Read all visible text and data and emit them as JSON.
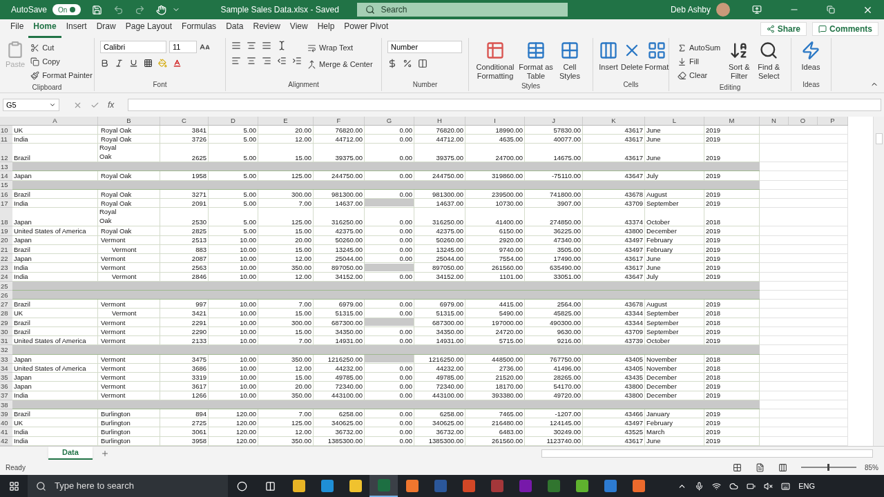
{
  "titlebar": {
    "autosave_label": "AutoSave",
    "autosave_on": true,
    "autosave_text": "On",
    "title": "Sample Sales Data.xlsx  -  Saved",
    "search_placeholder": "Search",
    "user": "Deb Ashby"
  },
  "tabs": [
    {
      "label": "File",
      "selected": false
    },
    {
      "label": "Home",
      "selected": true
    },
    {
      "label": "Insert",
      "selected": false
    },
    {
      "label": "Draw",
      "selected": false
    },
    {
      "label": "Page Layout",
      "selected": false
    },
    {
      "label": "Formulas",
      "selected": false
    },
    {
      "label": "Data",
      "selected": false
    },
    {
      "label": "Review",
      "selected": false
    },
    {
      "label": "View",
      "selected": false
    },
    {
      "label": "Help",
      "selected": false
    },
    {
      "label": "Power Pivot",
      "selected": false
    }
  ],
  "share": "Share",
  "comments": "Comments",
  "ribbon": {
    "clipboard": {
      "label": "Clipboard",
      "paste": "Paste",
      "paste_disabled": true,
      "cut": "Cut",
      "copy": "Copy",
      "format_painter": "Format Painter"
    },
    "font": {
      "label": "Font",
      "name": "Calibri",
      "size": "11"
    },
    "alignment": {
      "label": "Alignment",
      "wrap": "Wrap Text",
      "merge": "Merge & Center"
    },
    "number": {
      "label": "Number",
      "format": "Number"
    },
    "styles": {
      "label": "Styles",
      "buttons": [
        "Conditional Formatting",
        "Format as Table",
        "Cell Styles"
      ]
    },
    "cells": {
      "label": "Cells",
      "buttons": [
        "Insert",
        "Delete",
        "Format"
      ]
    },
    "editing": {
      "label": "Editing",
      "autosum": "AutoSum",
      "fill": "Fill",
      "clear": "Clear",
      "sort": "Sort & Filter",
      "find": "Find & Select"
    },
    "ideas": {
      "label": "Ideas",
      "button": "Ideas"
    }
  },
  "formula_bar": {
    "name_box": "G5",
    "fx": "fx"
  },
  "columns": [
    "A",
    "B",
    "C",
    "D",
    "E",
    "F",
    "G",
    "H",
    "I",
    "J",
    "K",
    "L",
    "M",
    "N",
    "O",
    "P"
  ],
  "rows": [
    {
      "n": "10",
      "kind": "data",
      "wrapped": false,
      "b_indented": false,
      "g_shaded": false,
      "cells": [
        "UK",
        "Royal Oak",
        "3841",
        "5.00",
        "20.00",
        "76820.00",
        "0.00",
        "76820.00",
        "18990.00",
        "57830.00",
        "43617",
        "June",
        "2019"
      ]
    },
    {
      "n": "11",
      "kind": "data",
      "wrapped": false,
      "b_indented": false,
      "g_shaded": false,
      "cells": [
        "India",
        "Royal Oak",
        "3726",
        "5.00",
        "12.00",
        "44712.00",
        "0.00",
        "44712.00",
        "4635.00",
        "40077.00",
        "43617",
        "June",
        "2019"
      ]
    },
    {
      "n": "12",
      "kind": "data",
      "wrapped": true,
      "b_indented": false,
      "g_shaded": false,
      "cells": [
        "Brazil",
        "Royal Oak",
        "2625",
        "5.00",
        "15.00",
        "39375.00",
        "0.00",
        "39375.00",
        "24700.00",
        "14675.00",
        "43617",
        "June",
        "2019"
      ]
    },
    {
      "n": "13",
      "kind": "band"
    },
    {
      "n": "14",
      "kind": "data",
      "wrapped": false,
      "b_indented": false,
      "g_shaded": false,
      "cells": [
        "Japan",
        "Royal Oak",
        "1958",
        "5.00",
        "125.00",
        "244750.00",
        "0.00",
        "244750.00",
        "319860.00",
        "-75110.00",
        "43647",
        "July",
        "2019"
      ]
    },
    {
      "n": "15",
      "kind": "band"
    },
    {
      "n": "16",
      "kind": "data",
      "wrapped": false,
      "b_indented": false,
      "g_shaded": false,
      "cells": [
        "Brazil",
        "Royal Oak",
        "3271",
        "5.00",
        "300.00",
        "981300.00",
        "0.00",
        "981300.00",
        "239500.00",
        "741800.00",
        "43678",
        "August",
        "2019"
      ]
    },
    {
      "n": "17",
      "kind": "data",
      "wrapped": false,
      "b_indented": false,
      "g_shaded": true,
      "cells": [
        "India",
        "Royal Oak",
        "2091",
        "5.00",
        "7.00",
        "14637.00",
        null,
        "14637.00",
        "10730.00",
        "3907.00",
        "43709",
        "September",
        "2019"
      ]
    },
    {
      "n": "18",
      "kind": "data",
      "wrapped": true,
      "b_indented": false,
      "g_shaded": false,
      "cells": [
        "Japan",
        "Royal Oak",
        "2530",
        "5.00",
        "125.00",
        "316250.00",
        "0.00",
        "316250.00",
        "41400.00",
        "274850.00",
        "43374",
        "October",
        "2018"
      ]
    },
    {
      "n": "19",
      "kind": "data",
      "wrapped": false,
      "b_indented": false,
      "g_shaded": false,
      "cells": [
        "United States of America",
        "Royal Oak",
        "2825",
        "5.00",
        "15.00",
        "42375.00",
        "0.00",
        "42375.00",
        "6150.00",
        "36225.00",
        "43800",
        "December",
        "2019"
      ]
    },
    {
      "n": "20",
      "kind": "data",
      "wrapped": false,
      "b_indented": false,
      "g_shaded": false,
      "cells": [
        "Japan",
        "Vermont",
        "2513",
        "10.00",
        "20.00",
        "50260.00",
        "0.00",
        "50260.00",
        "2920.00",
        "47340.00",
        "43497",
        "February",
        "2019"
      ]
    },
    {
      "n": "21",
      "kind": "data",
      "wrapped": false,
      "b_indented": true,
      "g_shaded": false,
      "cells": [
        "Brazil",
        "Vermont",
        "883",
        "10.00",
        "15.00",
        "13245.00",
        "0.00",
        "13245.00",
        "9740.00",
        "3505.00",
        "43497",
        "February",
        "2019"
      ]
    },
    {
      "n": "22",
      "kind": "data",
      "wrapped": false,
      "b_indented": false,
      "g_shaded": false,
      "cells": [
        "Japan",
        "Vermont",
        "2087",
        "10.00",
        "12.00",
        "25044.00",
        "0.00",
        "25044.00",
        "7554.00",
        "17490.00",
        "43617",
        "June",
        "2019"
      ]
    },
    {
      "n": "23",
      "kind": "data",
      "wrapped": false,
      "b_indented": false,
      "g_shaded": true,
      "cells": [
        "India",
        "Vermont",
        "2563",
        "10.00",
        "350.00",
        "897050.00",
        null,
        "897050.00",
        "261560.00",
        "635490.00",
        "43617",
        "June",
        "2019"
      ]
    },
    {
      "n": "24",
      "kind": "data",
      "wrapped": false,
      "b_indented": true,
      "g_shaded": false,
      "cells": [
        "India",
        "Vermont",
        "2846",
        "10.00",
        "12.00",
        "34152.00",
        "0.00",
        "34152.00",
        "1101.00",
        "33051.00",
        "43647",
        "July",
        "2019"
      ]
    },
    {
      "n": "25",
      "kind": "band"
    },
    {
      "n": "26",
      "kind": "band"
    },
    {
      "n": "27",
      "kind": "data",
      "wrapped": false,
      "b_indented": false,
      "g_shaded": false,
      "cells": [
        "Brazil",
        "Vermont",
        "997",
        "10.00",
        "7.00",
        "6979.00",
        "0.00",
        "6979.00",
        "4415.00",
        "2564.00",
        "43678",
        "August",
        "2019"
      ]
    },
    {
      "n": "28",
      "kind": "data",
      "wrapped": false,
      "b_indented": true,
      "g_shaded": false,
      "cells": [
        "UK",
        "Vermont",
        "3421",
        "10.00",
        "15.00",
        "51315.00",
        "0.00",
        "51315.00",
        "5490.00",
        "45825.00",
        "43344",
        "September",
        "2018"
      ]
    },
    {
      "n": "29",
      "kind": "data",
      "wrapped": false,
      "b_indented": false,
      "g_shaded": true,
      "cells": [
        "Brazil",
        "Vermont",
        "2291",
        "10.00",
        "300.00",
        "687300.00",
        null,
        "687300.00",
        "197000.00",
        "490300.00",
        "43344",
        "September",
        "2018"
      ]
    },
    {
      "n": "30",
      "kind": "data",
      "wrapped": false,
      "b_indented": false,
      "g_shaded": false,
      "cells": [
        "Brazil",
        "Vermont",
        "2290",
        "10.00",
        "15.00",
        "34350.00",
        "0.00",
        "34350.00",
        "24720.00",
        "9630.00",
        "43709",
        "September",
        "2019"
      ]
    },
    {
      "n": "31",
      "kind": "data",
      "wrapped": false,
      "b_indented": false,
      "g_shaded": false,
      "cells": [
        "United States of America",
        "Vermont",
        "2133",
        "10.00",
        "7.00",
        "14931.00",
        "0.00",
        "14931.00",
        "5715.00",
        "9216.00",
        "43739",
        "October",
        "2019"
      ]
    },
    {
      "n": "32",
      "kind": "band"
    },
    {
      "n": "33",
      "kind": "data",
      "wrapped": false,
      "b_indented": false,
      "g_shaded": true,
      "cells": [
        "Japan",
        "Vermont",
        "3475",
        "10.00",
        "350.00",
        "1216250.00",
        null,
        "1216250.00",
        "448500.00",
        "767750.00",
        "43405",
        "November",
        "2018"
      ]
    },
    {
      "n": "34",
      "kind": "data",
      "wrapped": false,
      "b_indented": false,
      "g_shaded": false,
      "cells": [
        "United States of America",
        "Vermont",
        "3686",
        "10.00",
        "12.00",
        "44232.00",
        "0.00",
        "44232.00",
        "2736.00",
        "41496.00",
        "43405",
        "November",
        "2018"
      ]
    },
    {
      "n": "35",
      "kind": "data",
      "wrapped": false,
      "b_indented": false,
      "g_shaded": false,
      "cells": [
        "Japan",
        "Vermont",
        "3319",
        "10.00",
        "15.00",
        "49785.00",
        "0.00",
        "49785.00",
        "21520.00",
        "28265.00",
        "43435",
        "December",
        "2018"
      ]
    },
    {
      "n": "36",
      "kind": "data",
      "wrapped": false,
      "b_indented": false,
      "g_shaded": false,
      "cells": [
        "Japan",
        "Vermont",
        "3617",
        "10.00",
        "20.00",
        "72340.00",
        "0.00",
        "72340.00",
        "18170.00",
        "54170.00",
        "43800",
        "December",
        "2019"
      ]
    },
    {
      "n": "37",
      "kind": "data",
      "wrapped": false,
      "b_indented": false,
      "g_shaded": false,
      "cells": [
        "India",
        "Vermont",
        "1266",
        "10.00",
        "350.00",
        "443100.00",
        "0.00",
        "443100.00",
        "393380.00",
        "49720.00",
        "43800",
        "December",
        "2019"
      ]
    },
    {
      "n": "38",
      "kind": "band"
    },
    {
      "n": "39",
      "kind": "data",
      "wrapped": false,
      "b_indented": false,
      "g_shaded": false,
      "cells": [
        "Brazil",
        "Burlington",
        "894",
        "120.00",
        "7.00",
        "6258.00",
        "0.00",
        "6258.00",
        "7465.00",
        "-1207.00",
        "43466",
        "January",
        "2019"
      ]
    },
    {
      "n": "40",
      "kind": "data",
      "wrapped": false,
      "b_indented": false,
      "g_shaded": false,
      "cells": [
        "UK",
        "Burlington",
        "2725",
        "120.00",
        "125.00",
        "340625.00",
        "0.00",
        "340625.00",
        "216480.00",
        "124145.00",
        "43497",
        "February",
        "2019"
      ]
    },
    {
      "n": "41",
      "kind": "data",
      "wrapped": false,
      "b_indented": false,
      "g_shaded": false,
      "cells": [
        "India",
        "Burlington",
        "3061",
        "120.00",
        "12.00",
        "36732.00",
        "0.00",
        "36732.00",
        "6483.00",
        "30249.00",
        "43525",
        "March",
        "2019"
      ]
    },
    {
      "n": "42",
      "kind": "data",
      "wrapped": false,
      "b_indented": false,
      "g_shaded": false,
      "cells": [
        "India",
        "Burlington",
        "3958",
        "120.00",
        "350.00",
        "1385300.00",
        "0.00",
        "1385300.00",
        "261560.00",
        "1123740.00",
        "43617",
        "June",
        "2019"
      ]
    }
  ],
  "sheet_tabs": [
    {
      "label": "Data",
      "selected": true
    }
  ],
  "status": {
    "text": "Ready",
    "zoom": "85%",
    "zoom_slider": {
      "level": 0.5
    }
  },
  "taskbar": {
    "search_placeholder": "Type here to search",
    "language": "ENG",
    "apps": [
      {
        "kind": "circle",
        "selected": false
      },
      {
        "kind": "taskview",
        "selected": false
      },
      {
        "kind": "tile",
        "color": "#e8b425",
        "selected": false
      },
      {
        "kind": "tile",
        "color": "#1f8fd6",
        "selected": false
      },
      {
        "kind": "tile",
        "color": "#f0c22e",
        "selected": false
      },
      {
        "kind": "tile",
        "color": "#1d6f42",
        "selected": true
      },
      {
        "kind": "tile",
        "color": "#f0762e",
        "selected": false
      },
      {
        "kind": "tile",
        "color": "#2b579a",
        "selected": false
      },
      {
        "kind": "tile",
        "color": "#d24726",
        "selected": false
      },
      {
        "kind": "tile",
        "color": "#a4373a",
        "selected": false
      },
      {
        "kind": "tile",
        "color": "#7719aa",
        "selected": false
      },
      {
        "kind": "tile",
        "color": "#31752f",
        "selected": false
      },
      {
        "kind": "tile",
        "color": "#5fb22e",
        "selected": false
      },
      {
        "kind": "tile",
        "color": "#2d7bd1",
        "selected": false
      },
      {
        "kind": "tile",
        "color": "#ec6a2c",
        "selected": false
      }
    ]
  }
}
